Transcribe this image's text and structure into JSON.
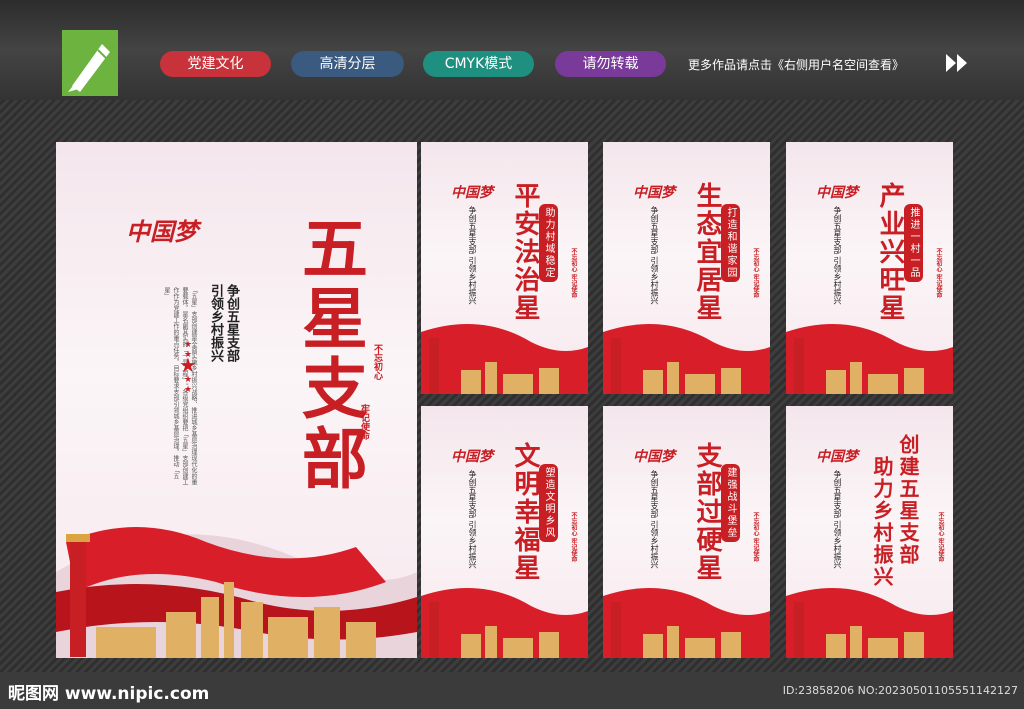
{
  "header": {
    "tags": [
      "党建文化",
      "高清分层",
      "CMYK模式",
      "请勿转载"
    ],
    "more_text": "更多作品请点击《右侧用户名空间查看》"
  },
  "main_poster": {
    "title": "五星支部",
    "heading_line1": "争创五星支部",
    "heading_line2": "引领乡村振兴",
    "body": "「五星」支部创建是全面实施乡村振兴战略、推进城乡基层治理现代化的重要载体，是名副其实的「一号工程」。各级党组织要把「五星」支部创建工作作为党建工作的重点任务，目标要求支部引领城乡基层治理，推动「五星」",
    "slogan_1": "不忘初心",
    "slogan_2": "牢记使命",
    "calligraphy": "中国梦"
  },
  "posters": [
    {
      "title": "平安法治星",
      "stamp": "助力村域稳定"
    },
    {
      "title": "生态宜居星",
      "stamp": "打造和谐家园"
    },
    {
      "title": "产业兴旺星",
      "stamp": "推进一村一品"
    },
    {
      "title": "文明幸福星",
      "stamp": "塑造文明乡风"
    },
    {
      "title": "支部过硬星",
      "stamp": "建强战斗堡垒"
    },
    {
      "title_line1": "创建五星支部",
      "title_line2": "助力乡村振兴"
    }
  ],
  "poster_sub": "争创五星支部 引领乡村振兴",
  "poster_slogan": "不忘初心 牢记使命",
  "footer": {
    "watermark": "昵图网 www.nipic.com",
    "id_text": "ID:23858206 NO:20230501105551142127"
  },
  "colors": {
    "accent": "#c81f24",
    "brand": "#6cb33f"
  }
}
